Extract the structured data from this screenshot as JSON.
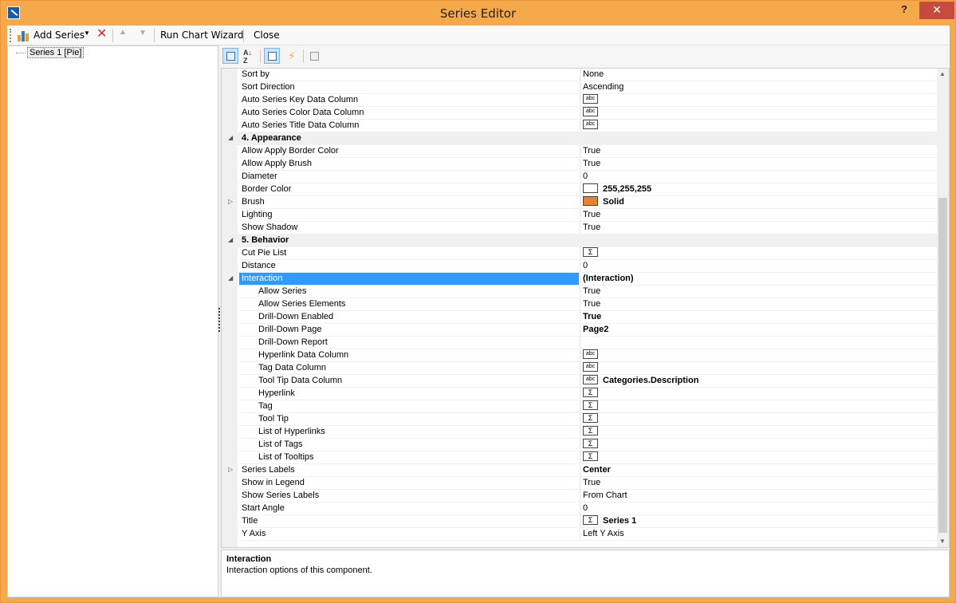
{
  "window": {
    "title": "Series Editor",
    "help": "?",
    "close": "✕"
  },
  "toolbar": {
    "add_series": "Add Series",
    "run_chart_wizard": "Run Chart Wizard",
    "close": "Close"
  },
  "tree": {
    "items": [
      {
        "label": "Series 1 [Pie]"
      }
    ]
  },
  "grid": {
    "rows": [
      {
        "name": "Sort by",
        "value": "None",
        "type": "text"
      },
      {
        "name": "Sort Direction",
        "value": "Ascending",
        "type": "text"
      },
      {
        "name": "Auto Series Key Data Column",
        "value": "",
        "type": "abc"
      },
      {
        "name": "Auto Series Color Data Column",
        "value": "",
        "type": "abc"
      },
      {
        "name": "Auto Series Title Data Column",
        "value": "",
        "type": "abc"
      },
      {
        "name": "4. Appearance",
        "value": "",
        "type": "category"
      },
      {
        "name": "Allow Apply Border Color",
        "value": "True",
        "type": "text"
      },
      {
        "name": "Allow Apply Brush",
        "value": "True",
        "type": "text"
      },
      {
        "name": "Diameter",
        "value": "0",
        "type": "text"
      },
      {
        "name": "Border Color",
        "value": "255,255,255",
        "type": "swatch-white"
      },
      {
        "name": "Brush",
        "value": "Solid",
        "type": "swatch-orange"
      },
      {
        "name": "Lighting",
        "value": "True",
        "type": "text"
      },
      {
        "name": "Show Shadow",
        "value": "True",
        "type": "text"
      },
      {
        "name": "5. Behavior",
        "value": "",
        "type": "category"
      },
      {
        "name": "Cut Pie List",
        "value": "",
        "type": "sigma"
      },
      {
        "name": "Distance",
        "value": "0",
        "type": "text"
      },
      {
        "name": "Interaction",
        "value": "(Interaction)",
        "type": "selected"
      },
      {
        "name": "Allow Series",
        "value": "True",
        "type": "text-indent"
      },
      {
        "name": "Allow Series Elements",
        "value": "True",
        "type": "text-indent"
      },
      {
        "name": "Drill-Down Enabled",
        "value": "True",
        "type": "bold-indent"
      },
      {
        "name": "Drill-Down Page",
        "value": "Page2",
        "type": "bold-indent"
      },
      {
        "name": "Drill-Down Report",
        "value": "",
        "type": "text-indent"
      },
      {
        "name": "Hyperlink Data Column",
        "value": "",
        "type": "abc-indent"
      },
      {
        "name": "Tag Data Column",
        "value": "",
        "type": "abc-indent"
      },
      {
        "name": "Tool Tip Data Column",
        "value": "Categories.Description",
        "type": "abc-indent"
      },
      {
        "name": "Hyperlink",
        "value": "",
        "type": "sigma-indent"
      },
      {
        "name": "Tag",
        "value": "",
        "type": "sigma-indent"
      },
      {
        "name": "Tool Tip",
        "value": "",
        "type": "sigma-indent"
      },
      {
        "name": "List of Hyperlinks",
        "value": "",
        "type": "sigma-indent"
      },
      {
        "name": "List of Tags",
        "value": "",
        "type": "sigma-indent"
      },
      {
        "name": "List of Tooltips",
        "value": "",
        "type": "sigma-indent"
      },
      {
        "name": "Series Labels",
        "value": "Center",
        "type": "bold-expand"
      },
      {
        "name": "Show in Legend",
        "value": "True",
        "type": "text"
      },
      {
        "name": "Show Series Labels",
        "value": "From Chart",
        "type": "text"
      },
      {
        "name": "Start Angle",
        "value": "0",
        "type": "text"
      },
      {
        "name": "Title",
        "value": "Series 1",
        "type": "sigma"
      },
      {
        "name": "Y Axis",
        "value": "Left Y Axis",
        "type": "text"
      }
    ]
  },
  "description": {
    "title": "Interaction",
    "text": "Interaction options of this component."
  },
  "colors": {
    "accent": "#f5a94a",
    "selection": "#3399ff",
    "brush": "#e8822f",
    "close": "#c74a3f"
  }
}
